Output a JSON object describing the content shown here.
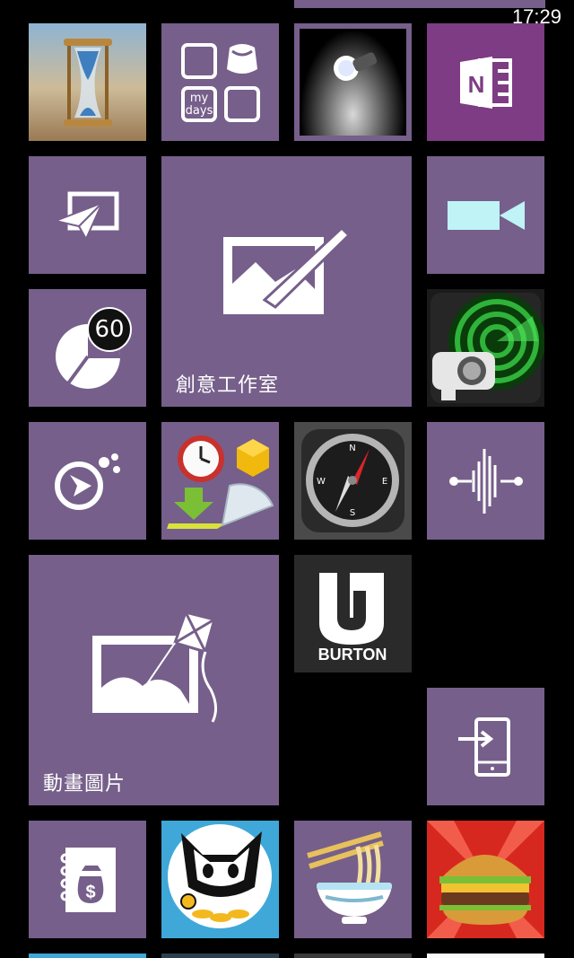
{
  "status_bar": {
    "time": "17:29"
  },
  "tiles": {
    "hourglass": {
      "icon": "hourglass-icon"
    },
    "mydays": {
      "text_line1": "my",
      "text_line2": "days",
      "icon": "my-days-icon"
    },
    "flashlight": {
      "icon": "flashlight-icon"
    },
    "onenote": {
      "icon": "onenote-icon",
      "letter": "N"
    },
    "paper_plane": {
      "icon": "paper-plane-photo-icon"
    },
    "creative_studio": {
      "label": "創意工作室",
      "icon": "photo-brush-icon"
    },
    "video": {
      "icon": "video-camera-icon"
    },
    "pie": {
      "icon": "pie-chart-icon",
      "badge": "60"
    },
    "radar_camera": {
      "icon": "radar-camera-icon"
    },
    "here_drive": {
      "icon": "navigation-icon"
    },
    "tools": {
      "icon": "clock-cube-protractor-icon"
    },
    "compass": {
      "icon": "compass-icon",
      "n": "N",
      "e": "E",
      "s": "S",
      "w": "W"
    },
    "voice": {
      "icon": "sound-wave-icon"
    },
    "kite_pictures": {
      "label": "動畫圖片",
      "icon": "kite-photo-icon"
    },
    "burton": {
      "text": "BURTON",
      "icon": "burton-logo-icon"
    },
    "transfer": {
      "icon": "phone-transfer-icon"
    },
    "money_notes": {
      "icon": "money-notebook-icon",
      "symbol": "$"
    },
    "cat_game": {
      "icon": "cat-coins-icon"
    },
    "noodles": {
      "icon": "noodle-bowl-icon"
    },
    "burger": {
      "icon": "hamburger-icon"
    }
  }
}
